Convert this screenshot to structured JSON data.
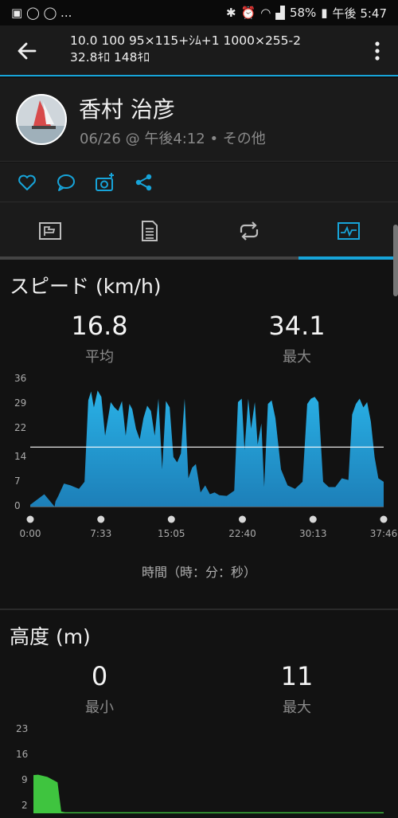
{
  "status_bar": {
    "battery": "58%",
    "time": "午後 5:47",
    "left_icons": "▣ ◯ ◯ ..."
  },
  "header": {
    "title_line1": "10.0 100 95×115+ｼﾑ+1 1000×255-2",
    "title_line2": "32.8ｷﾛ 148ｷﾛ"
  },
  "profile": {
    "name": "香村 治彦",
    "meta": "06/26 @ 午後4:12 • その他"
  },
  "speed": {
    "title": "スピード (km/h)",
    "avg_value": "16.8",
    "avg_label": "平均",
    "max_value": "34.1",
    "max_label": "最大",
    "x_caption": "時間（時：分：秒）"
  },
  "altitude": {
    "title": "高度 (m)",
    "min_value": "0",
    "min_label": "最小",
    "max_value": "11",
    "max_label": "最大"
  },
  "colors": {
    "accent": "#17a4d9",
    "speed_fill_top": "#29b1e6",
    "speed_fill_bottom": "#1d7fb8",
    "alt_fill": "#3fc43f"
  },
  "chart_data": [
    {
      "type": "area",
      "ylabel": "",
      "xlabel": "時間（時：分：秒）",
      "yticks": [
        "0",
        "7",
        "14",
        "22",
        "29",
        "36"
      ],
      "xticks": [
        "0:00",
        "7:33",
        "15:05",
        "22:40",
        "30:13",
        "37:46"
      ],
      "ylim": [
        0,
        36
      ],
      "xlim": [
        0,
        37.77
      ],
      "average_line": 16.8,
      "x": [
        0,
        1.5,
        2.6,
        2.7,
        3.0,
        3.6,
        4.3,
        5.2,
        5.8,
        6.2,
        6.5,
        6.8,
        7.2,
        7.6,
        8.0,
        8.6,
        9.0,
        9.4,
        9.8,
        10.2,
        10.6,
        10.9,
        11.3,
        11.7,
        12.1,
        12.5,
        12.9,
        13.3,
        13.7,
        14.1,
        14.5,
        14.9,
        15.3,
        15.7,
        16.1,
        16.5,
        16.9,
        17.3,
        17.7,
        18.2,
        18.7,
        19.2,
        19.7,
        20.2,
        21.0,
        21.8,
        22.2,
        22.6,
        22.9,
        23.3,
        23.6,
        24.0,
        24.3,
        24.7,
        25.0,
        25.4,
        25.8,
        26.2,
        26.8,
        27.5,
        28.3,
        29.1,
        29.6,
        30.0,
        30.4,
        30.8,
        31.3,
        31.9,
        32.6,
        33.3,
        34.0,
        34.4,
        34.8,
        35.2,
        35.6,
        36.0,
        36.4,
        36.8,
        37.2,
        37.77
      ],
      "series": [
        {
          "values": [
            0.5,
            3.5,
            0,
            1.5,
            3.0,
            6.5,
            6.0,
            5.0,
            7.0,
            30.0,
            32.5,
            28.0,
            32.8,
            31.0,
            20.0,
            29.5,
            28.0,
            27.0,
            29.8,
            20.0,
            29.0,
            27.5,
            22.0,
            19.0,
            25.0,
            28.5,
            27.0,
            20.0,
            30.5,
            10.5,
            29.8,
            28.0,
            14.0,
            12.5,
            15.0,
            30.5,
            8.0,
            11.0,
            12.0,
            4.0,
            6.0,
            3.5,
            4.0,
            3.2,
            3.0,
            4.5,
            29.5,
            30.5,
            16.0,
            30.5,
            22.0,
            29.5,
            17.5,
            23.5,
            5.5,
            29.0,
            30.0,
            25.0,
            10.5,
            6.0,
            5.0,
            7.0,
            29.0,
            30.5,
            31.0,
            29.5,
            7.0,
            5.5,
            5.5,
            8.0,
            7.5,
            26.0,
            29.0,
            30.5,
            28.0,
            29.5,
            24.0,
            14.0,
            8.0,
            7.0
          ]
        }
      ]
    },
    {
      "type": "area",
      "ylabel": "",
      "yticks": [
        "2",
        "9",
        "16",
        "23"
      ],
      "ylim": [
        0,
        23
      ],
      "x": [
        0,
        0.5,
        1.5,
        2.6,
        3.0,
        3.4,
        37.77
      ],
      "series": [
        {
          "values": [
            10.5,
            10.6,
            10,
            8.5,
            0.5,
            0.3,
            0.3
          ]
        }
      ]
    }
  ]
}
